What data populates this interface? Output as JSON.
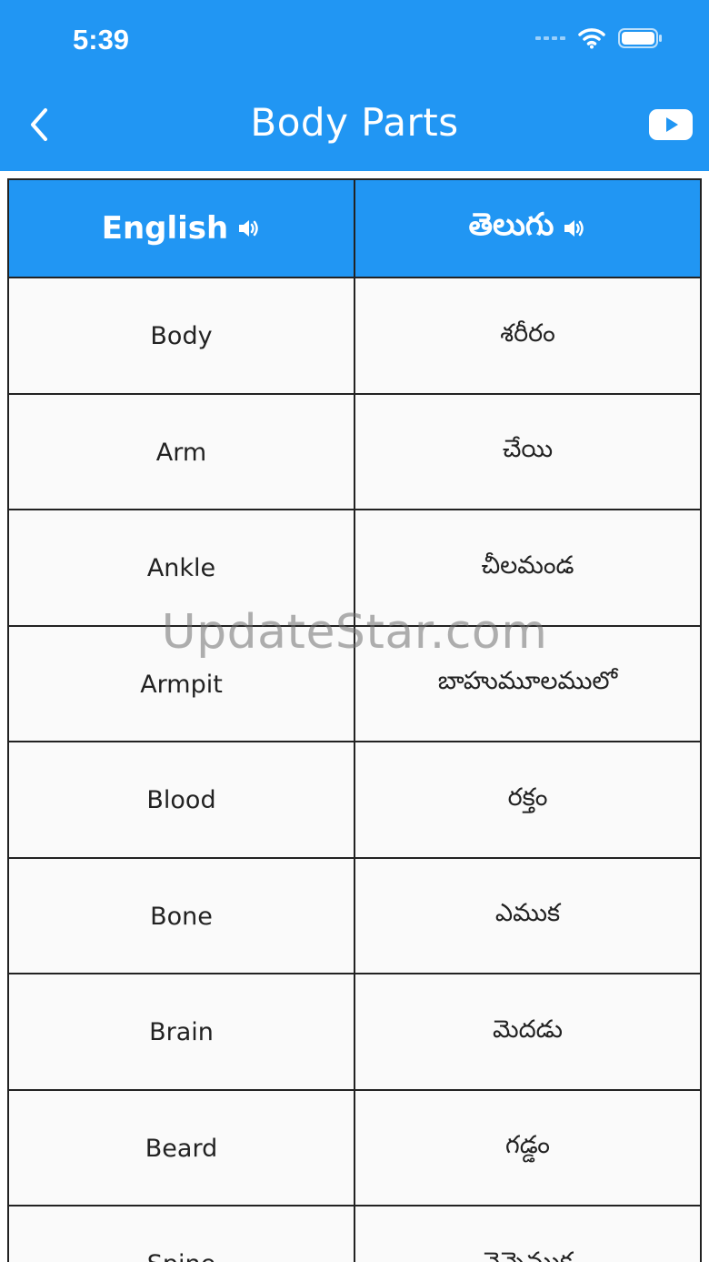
{
  "status_bar": {
    "time": "5:39"
  },
  "app_bar": {
    "title": "Body Parts"
  },
  "table": {
    "headers": [
      "English",
      "తెలుగు"
    ],
    "rows": [
      [
        "Body",
        "శరీరం"
      ],
      [
        "Arm",
        "చేయి"
      ],
      [
        "Ankle",
        "చీలమండ"
      ],
      [
        "Armpit",
        "బాహుమూలములో"
      ],
      [
        "Blood",
        "రక్తం"
      ],
      [
        "Bone",
        "ఎముక"
      ],
      [
        "Brain",
        "మెదడు"
      ],
      [
        "Beard",
        "గడ్డం"
      ],
      [
        "Spine",
        "వెన్నెముక"
      ]
    ]
  },
  "watermark": "UpdateStar.com",
  "colors": {
    "primary": "#2196f3",
    "row_bg": "#fafafa",
    "border": "#222222"
  },
  "icons": [
    "back-chevron-icon",
    "youtube-icon",
    "speaker-icon",
    "wifi-icon",
    "battery-icon",
    "cellular-signal-icon"
  ]
}
